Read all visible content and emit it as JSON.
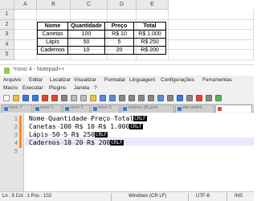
{
  "excel": {
    "columns": [
      "A",
      "B",
      "C",
      "D",
      "E"
    ],
    "rows": [
      "1",
      "2",
      "3",
      "4",
      "5"
    ],
    "table": {
      "headers": [
        "Nome",
        "Quantidade",
        "Preço",
        "Total"
      ],
      "rows": [
        [
          "Canetas",
          "100",
          "R$ 10",
          "R$ 1.000"
        ],
        [
          "Lápis",
          "50",
          "5",
          "R$ 250"
        ],
        [
          "Cadernos",
          "10",
          "20",
          "R$ 200"
        ]
      ]
    }
  },
  "notepad": {
    "title": "*novo 4 - Notepad++",
    "menu_row1": [
      "Arquivo",
      "Editar",
      "Localizar",
      "Visualizar",
      "Formatar",
      "Linguagem",
      "Configurações",
      "Ferramentas"
    ],
    "menu_row2": [
      "Macro",
      "Executar",
      "Plugins",
      "Janela",
      "?"
    ],
    "tabs": [
      "novo 7",
      "novo 1",
      "novo 2",
      "novo 3",
      "cetores (8).json",
      "site.webm"
    ],
    "line_numbers": [
      "1",
      "2",
      "3",
      "4",
      "5"
    ],
    "lines": [
      {
        "cells": [
          "Nome",
          "Quantidade",
          "Preço",
          "Total"
        ],
        "eol": "CRLF"
      },
      {
        "cells": [
          "Canetas",
          "100",
          "R$ 10",
          "R$ 1.000"
        ],
        "eol": "CRLF"
      },
      {
        "cells": [
          "Lápis",
          "50",
          "5",
          "R$ 250"
        ],
        "eol": "CRLF"
      },
      {
        "cells": [
          "Cadernos",
          "10",
          "20",
          "R$ 200"
        ],
        "eol": "CRLF"
      }
    ],
    "status": {
      "position": "Ln : 5    Col : 1    Pos : 102",
      "eol_mode": "Windows (CR LF)",
      "encoding": "UTF-8",
      "insert_mode": "INS"
    }
  }
}
